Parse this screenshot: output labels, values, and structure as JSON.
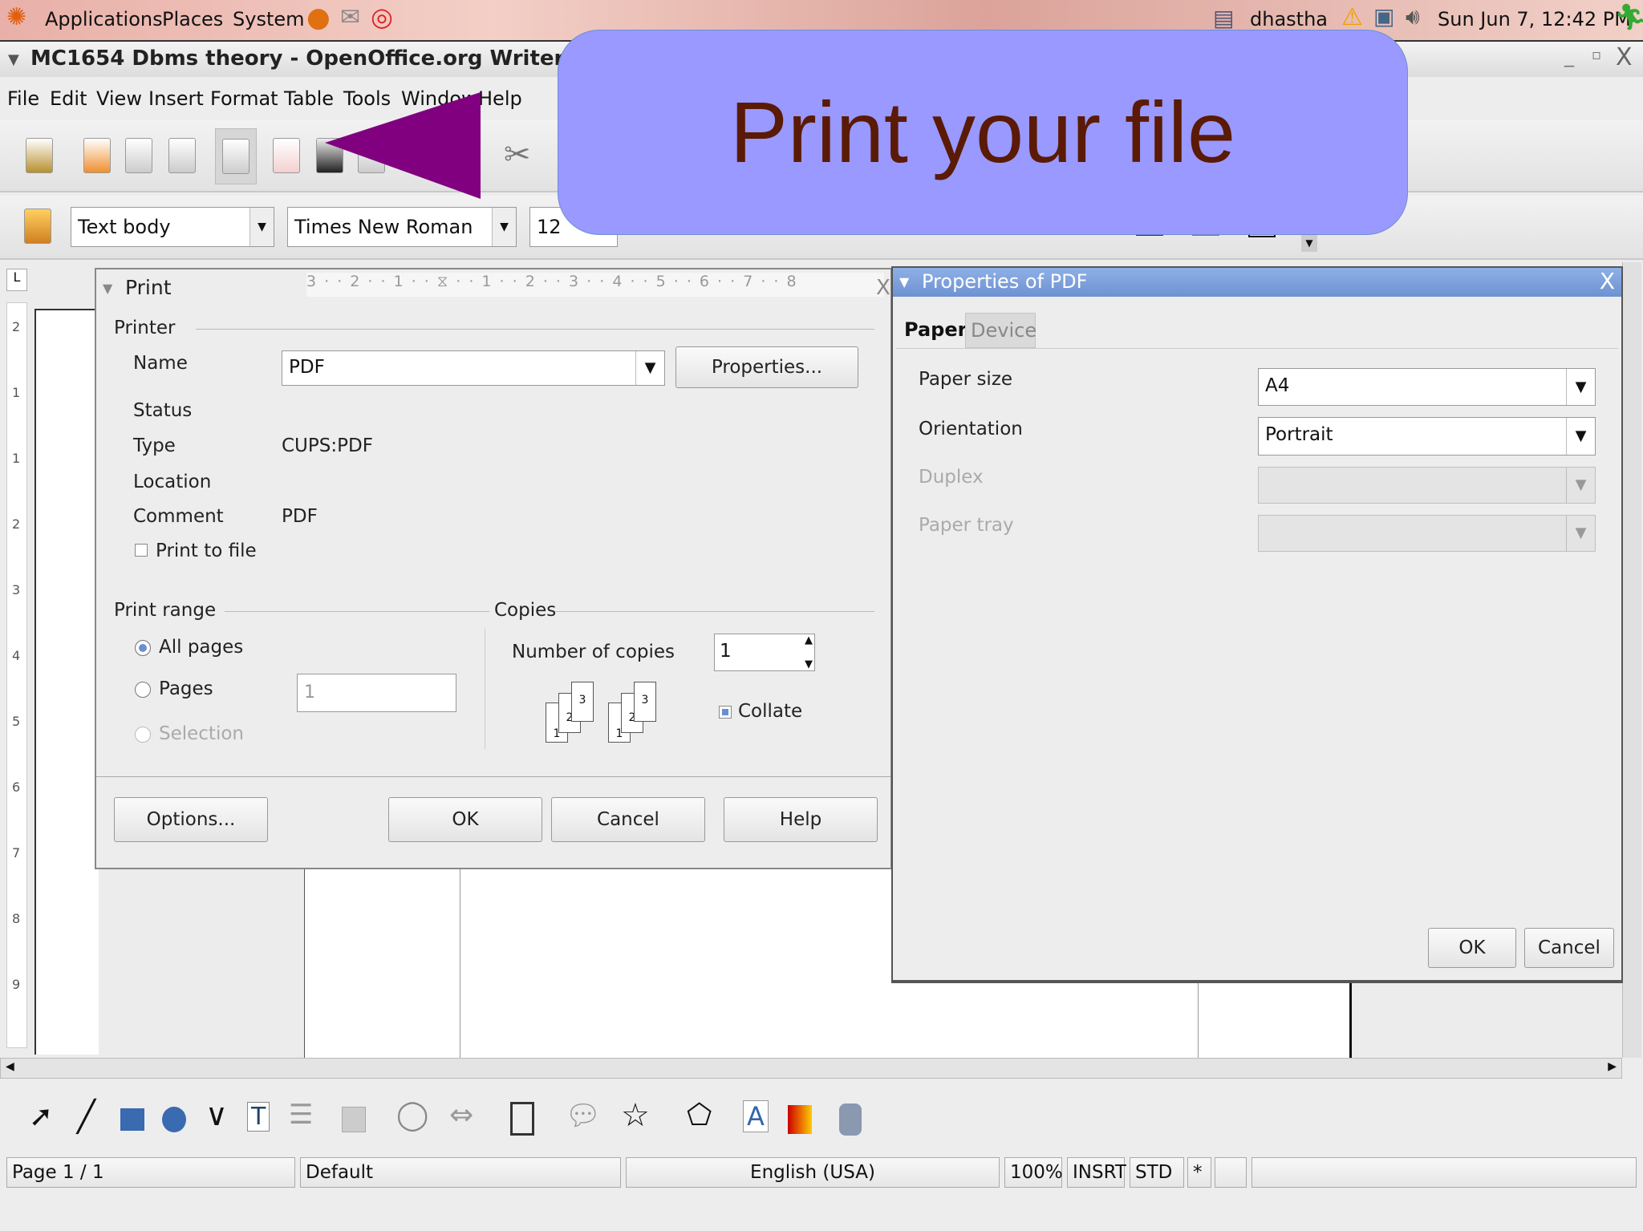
{
  "panel": {
    "applications": "Applications",
    "places": "Places",
    "system": "System",
    "user": "dhastha",
    "clock": "Sun Jun  7, 12:42 PM"
  },
  "window": {
    "title": "MC1654 Dbms theory - OpenOffice.org Writer"
  },
  "menu": [
    "File",
    "Edit",
    "View",
    "Insert",
    "Format",
    "Table",
    "Tools",
    "Window",
    "Help"
  ],
  "formatting": {
    "style": "Text body",
    "font": "Times New Roman",
    "size": "12",
    "font_color": "#3a10c0",
    "highlight_color": "#ff3366"
  },
  "callout": {
    "text": "Print your file",
    "bg": "#9999ff",
    "text_color": "#5a1a05",
    "arrow_color": "#800080"
  },
  "ruler": {
    "horizontal": [
      "3",
      "2",
      "1",
      "1",
      "2",
      "3",
      "4",
      "5",
      "6",
      "7",
      "8"
    ],
    "vertical": [
      "2",
      "1",
      "1",
      "2",
      "3",
      "4",
      "5",
      "6",
      "7",
      "8",
      "9"
    ]
  },
  "print_dialog": {
    "title": "Print",
    "printer_section": "Printer",
    "name_label": "Name",
    "name_value": "PDF",
    "properties_button": "Properties...",
    "status_label": "Status",
    "type_label": "Type",
    "type_value": "CUPS:PDF",
    "location_label": "Location",
    "comment_label": "Comment",
    "comment_value": "PDF",
    "print_to_file": "Print to file",
    "print_range_section": "Print range",
    "all_pages": "All pages",
    "pages": "Pages",
    "pages_value": "1",
    "selection": "Selection",
    "copies_section": "Copies",
    "number_of_copies": "Number of copies",
    "copies_value": "1",
    "collate": "Collate",
    "options_button": "Options...",
    "ok_button": "OK",
    "cancel_button": "Cancel",
    "help_button": "Help"
  },
  "properties_dialog": {
    "title": "Properties of PDF",
    "tabs": [
      "Paper",
      "Device"
    ],
    "paper_size_label": "Paper size",
    "paper_size": "A4",
    "orientation_label": "Orientation",
    "orientation": "Portrait",
    "duplex_label": "Duplex",
    "paper_tray_label": "Paper tray",
    "ok_button": "OK",
    "cancel_button": "Cancel"
  },
  "status": {
    "page": "Page 1 / 1",
    "style": "Default",
    "language": "English (USA)",
    "zoom": "100%",
    "mode": "INSRT",
    "selection": "STD",
    "modified": "*"
  }
}
